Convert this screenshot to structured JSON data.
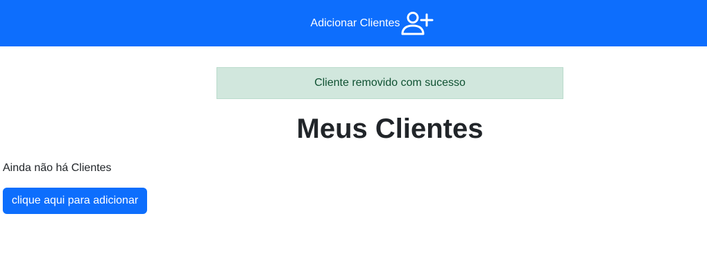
{
  "navbar": {
    "link_label": "Adicionar Clientes",
    "link_icon": "person-plus-icon",
    "background": "#0d6efd"
  },
  "alert": {
    "message": "Cliente removido com sucesso",
    "type": "success",
    "background": "#d1e7dd",
    "text_color": "#0f5132"
  },
  "main": {
    "title": "Meus Clientes",
    "empty_message": "Ainda não há Clientes",
    "add_button_label": "clique aqui para adicionar",
    "button_color": "#0d6efd"
  }
}
